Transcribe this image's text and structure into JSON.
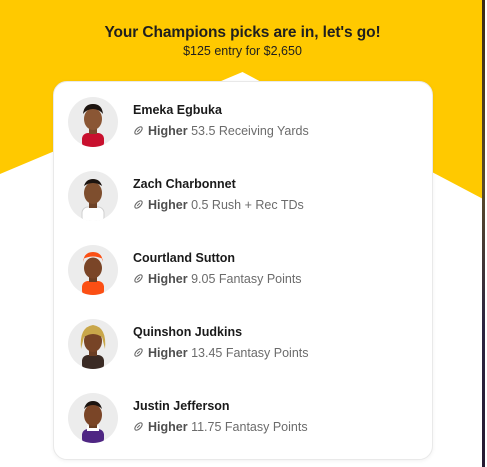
{
  "header": {
    "title": "Your Champions picks are in, let's go!",
    "subtitle": "$125 entry for $2,650"
  },
  "picks": [
    {
      "name": "Emeka Egbuka",
      "direction": "Higher",
      "line": "53.5 Receiving Yards",
      "jersey_color": "#c8102e"
    },
    {
      "name": "Zach Charbonnet",
      "direction": "Higher",
      "line": "0.5 Rush + Rec TDs",
      "jersey_color": "#ffffff"
    },
    {
      "name": "Courtland Sutton",
      "direction": "Higher",
      "line": "9.05 Fantasy Points",
      "jersey_color": "#fb4f14"
    },
    {
      "name": "Quinshon Judkins",
      "direction": "Higher",
      "line": "13.45 Fantasy Points",
      "jersey_color": "#3a2a24"
    },
    {
      "name": "Justin Jefferson",
      "direction": "Higher",
      "line": "11.75 Fantasy Points",
      "jersey_color": "#4f2683"
    }
  ],
  "icons": {
    "pick": "football-icon"
  },
  "colors": {
    "background": "#ffc900",
    "card": "#ffffff",
    "text": "#1a1a1a",
    "muted": "#6b6b6b"
  }
}
